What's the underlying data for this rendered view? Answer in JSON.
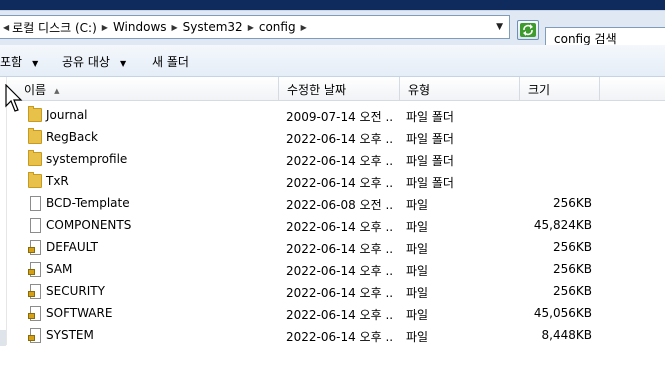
{
  "address_bar": {
    "crumbs": [
      "로컬 디스크 (C:)",
      "Windows",
      "System32",
      "config"
    ],
    "search_placeholder": "config 검색"
  },
  "toolbar": {
    "include_label": "포함",
    "share_label": "공유 대상",
    "new_folder_label": "새 폴더"
  },
  "columns": {
    "name": "이름",
    "date": "수정한 날짜",
    "type": "유형",
    "size": "크기"
  },
  "files": [
    {
      "name": "Journal",
      "date": "2009-07-14 오전 ...",
      "type": "파일 폴더",
      "size": "",
      "icon": "folder-icon"
    },
    {
      "name": "RegBack",
      "date": "2022-06-14 오후 ...",
      "type": "파일 폴더",
      "size": "",
      "icon": "folder-icon"
    },
    {
      "name": "systemprofile",
      "date": "2022-06-14 오후 ...",
      "type": "파일 폴더",
      "size": "",
      "icon": "folder-icon"
    },
    {
      "name": "TxR",
      "date": "2022-06-14 오후 ...",
      "type": "파일 폴더",
      "size": "",
      "icon": "folder-icon"
    },
    {
      "name": "BCD-Template",
      "date": "2022-06-08 오전 ...",
      "type": "파일",
      "size": "256KB",
      "icon": "file-icon"
    },
    {
      "name": "COMPONENTS",
      "date": "2022-06-14 오후 ...",
      "type": "파일",
      "size": "45,824KB",
      "icon": "file-icon"
    },
    {
      "name": "DEFAULT",
      "date": "2022-06-14 오후 ...",
      "type": "파일",
      "size": "256KB",
      "icon": "locked-file-icon"
    },
    {
      "name": "SAM",
      "date": "2022-06-14 오후 ...",
      "type": "파일",
      "size": "256KB",
      "icon": "locked-file-icon"
    },
    {
      "name": "SECURITY",
      "date": "2022-06-14 오후 ...",
      "type": "파일",
      "size": "256KB",
      "icon": "locked-file-icon"
    },
    {
      "name": "SOFTWARE",
      "date": "2022-06-14 오후 ...",
      "type": "파일",
      "size": "45,056KB",
      "icon": "locked-file-icon"
    },
    {
      "name": "SYSTEM",
      "date": "2022-06-14 오후 ...",
      "type": "파일",
      "size": "8,448KB",
      "icon": "locked-file-icon"
    }
  ]
}
